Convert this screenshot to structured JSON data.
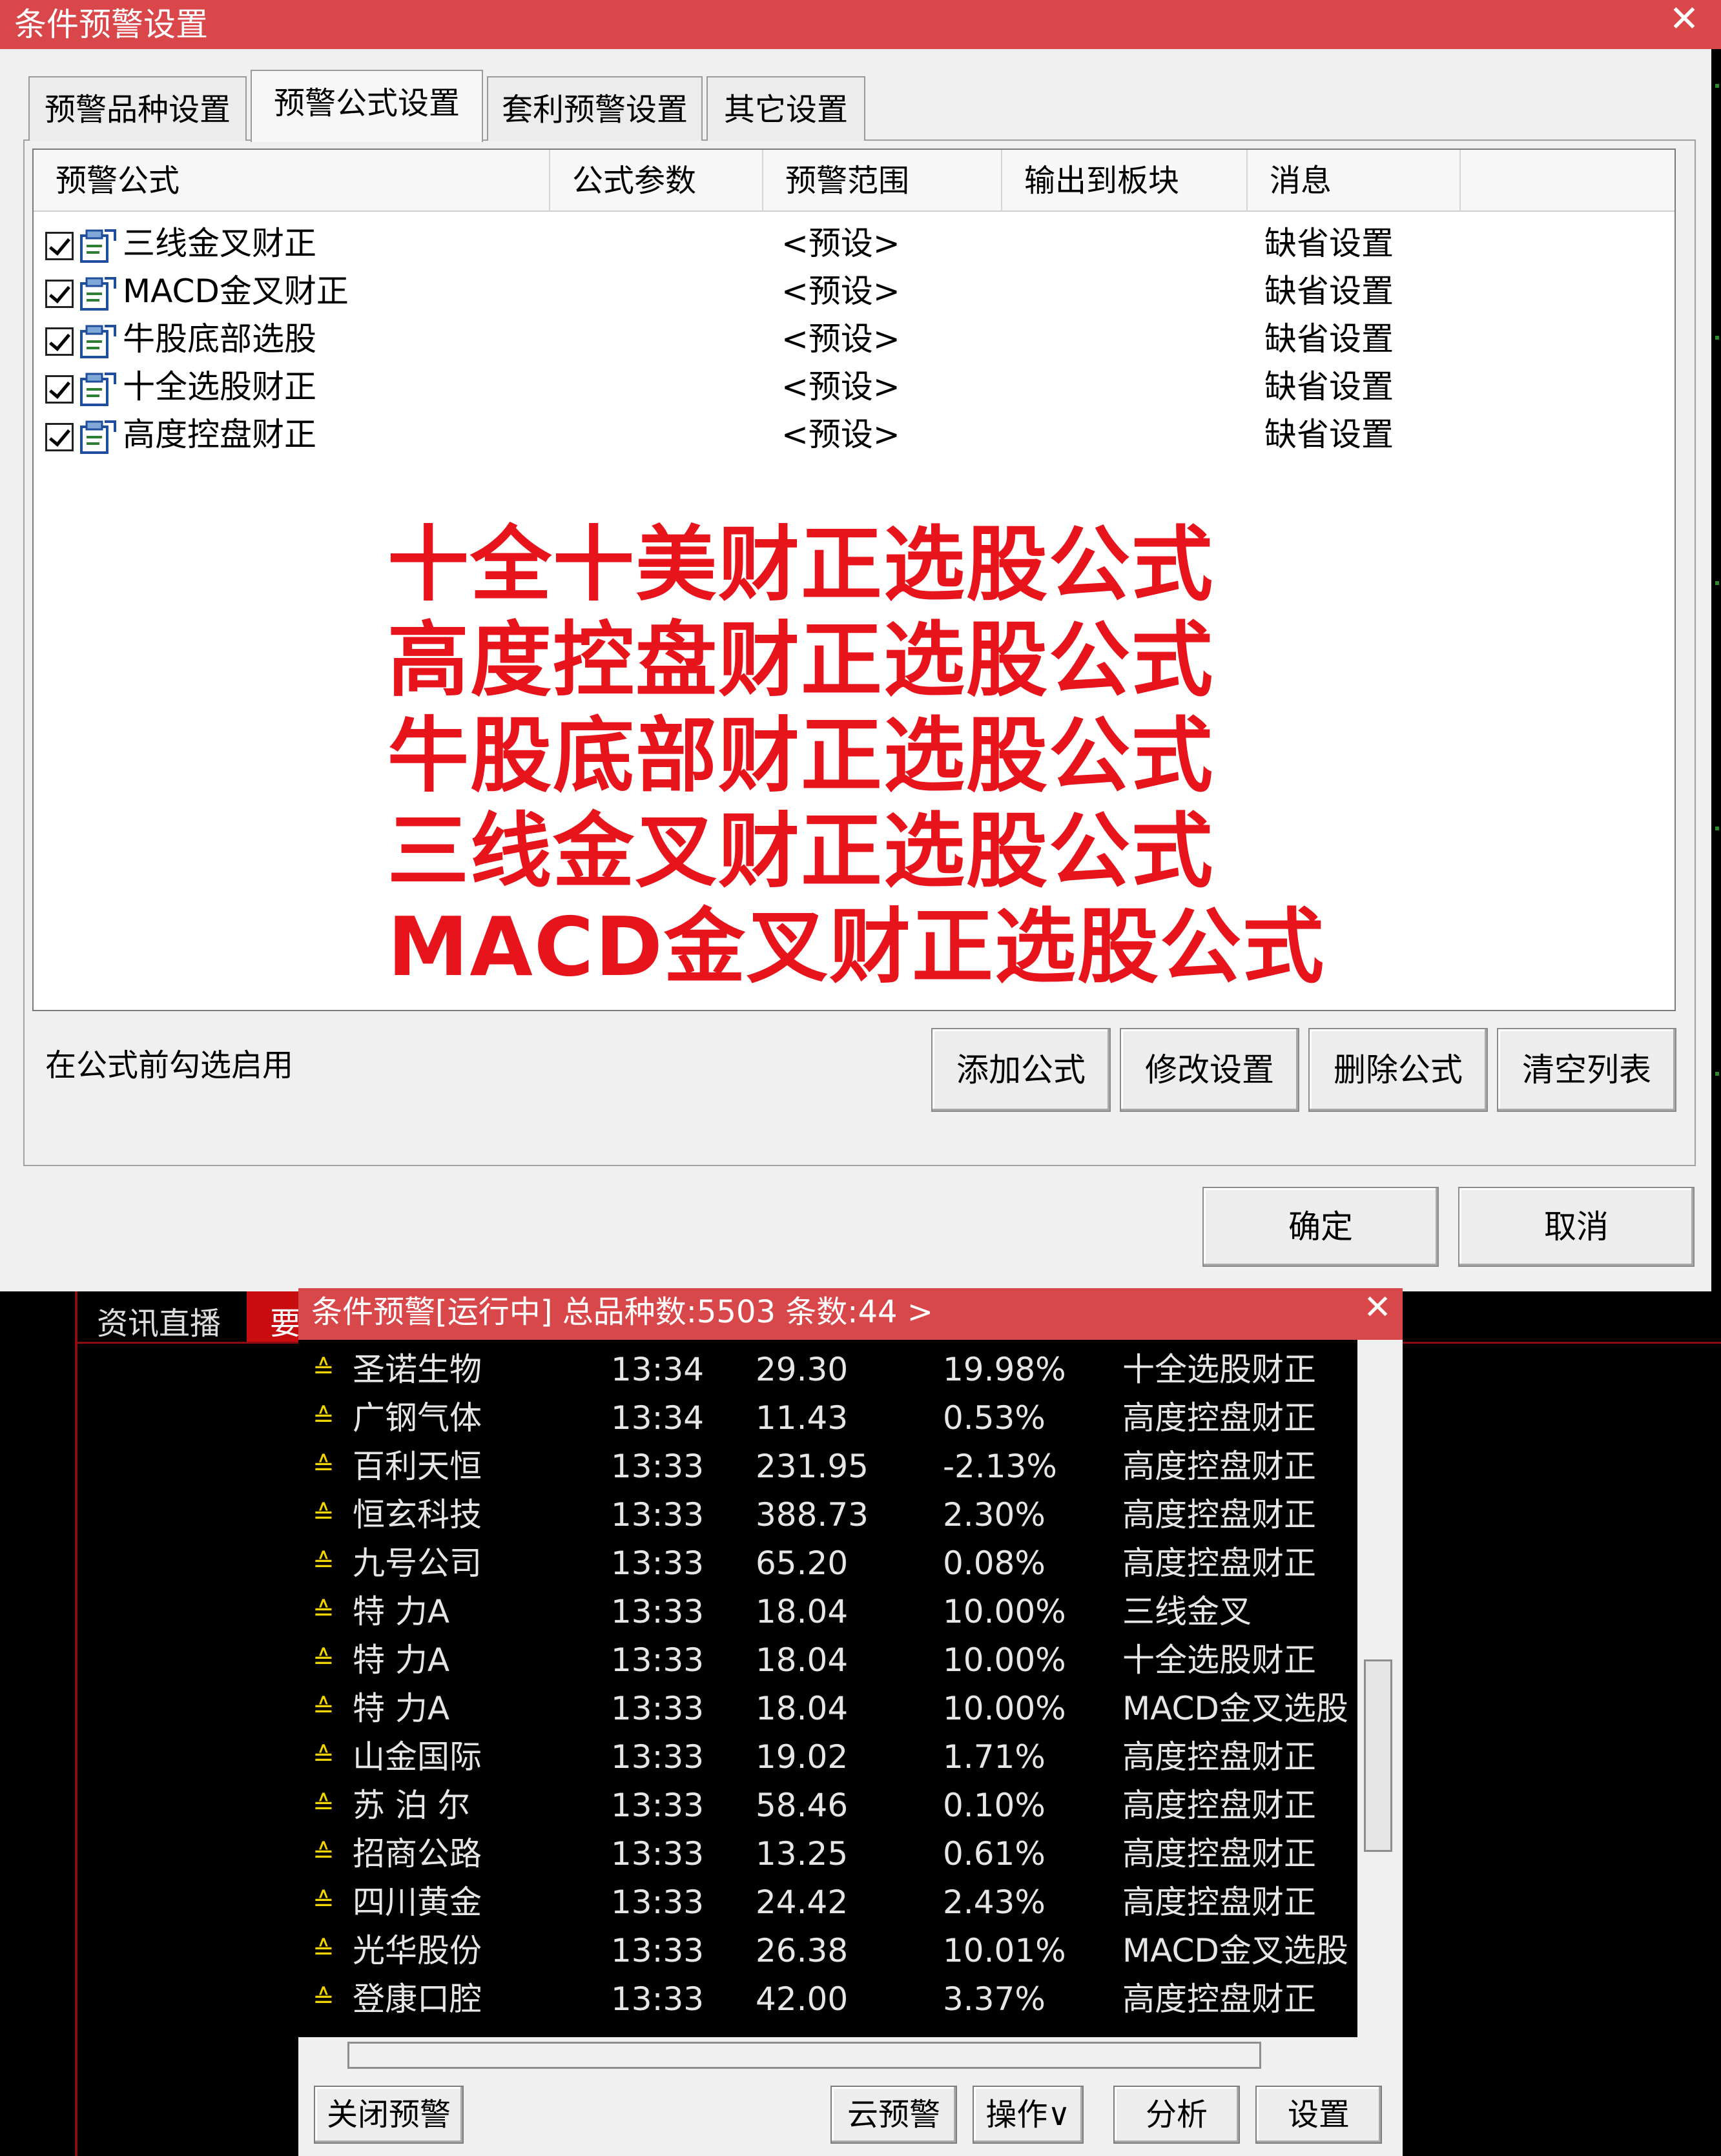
{
  "dialog": {
    "title": "条件预警设置",
    "close_glyph": "✕",
    "tabs": [
      "预警品种设置",
      "预警公式设置",
      "套利预警设置",
      "其它设置"
    ],
    "active_tab": "预警公式设置",
    "columns": [
      "预警公式",
      "公式参数",
      "预警范围",
      "输出到板块",
      "消息"
    ],
    "rows": [
      {
        "name": "三线金叉财正",
        "range": "<预设>",
        "msg": "缺省设置",
        "checked": true
      },
      {
        "name": "MACD金叉财正",
        "range": "<预设>",
        "msg": "缺省设置",
        "checked": true
      },
      {
        "name": "牛股底部选股",
        "range": "<预设>",
        "msg": "缺省设置",
        "checked": true
      },
      {
        "name": "十全选股财正",
        "range": "<预设>",
        "msg": "缺省设置",
        "checked": true
      },
      {
        "name": "高度控盘财正",
        "range": "<预设>",
        "msg": "缺省设置",
        "checked": true
      }
    ],
    "overlay_lines": [
      "十全十美财正选股公式",
      "高度控盘财正选股公式",
      "牛股底部财正选股公式",
      "三线金叉财正选股公式",
      "MACD金叉财正选股公式"
    ],
    "hint": "在公式前勾选启用",
    "buttons": {
      "add": "添加公式",
      "modify": "修改设置",
      "delete": "删除公式",
      "clear": "清空列表"
    },
    "ok": "确定",
    "cancel": "取消"
  },
  "background": {
    "news_tab": "资讯直播",
    "news_tab_cut": "要"
  },
  "alert_window": {
    "title": "条件预警[运行中] 总品种数:5503 条数:44  >",
    "close_glyph": "✕",
    "rows": [
      {
        "name": "圣诺生物",
        "time": "13:34",
        "price": "29.30",
        "pct": "19.98%",
        "formula": "十全选股财正"
      },
      {
        "name": "广钢气体",
        "time": "13:34",
        "price": "11.43",
        "pct": "0.53%",
        "formula": "高度控盘财正"
      },
      {
        "name": "百利天恒",
        "time": "13:33",
        "price": "231.95",
        "pct": "-2.13%",
        "formula": "高度控盘财正"
      },
      {
        "name": "恒玄科技",
        "time": "13:33",
        "price": "388.73",
        "pct": "2.30%",
        "formula": "高度控盘财正"
      },
      {
        "name": "九号公司",
        "time": "13:33",
        "price": "65.20",
        "pct": "0.08%",
        "formula": "高度控盘财正"
      },
      {
        "name": "特 力A",
        "time": "13:33",
        "price": "18.04",
        "pct": "10.00%",
        "formula": "三线金叉"
      },
      {
        "name": "特 力A",
        "time": "13:33",
        "price": "18.04",
        "pct": "10.00%",
        "formula": "十全选股财正"
      },
      {
        "name": "特 力A",
        "time": "13:33",
        "price": "18.04",
        "pct": "10.00%",
        "formula": "MACD金叉选股"
      },
      {
        "name": "山金国际",
        "time": "13:33",
        "price": "19.02",
        "pct": "1.71%",
        "formula": "高度控盘财正"
      },
      {
        "name": "苏 泊 尔",
        "time": "13:33",
        "price": "58.46",
        "pct": "0.10%",
        "formula": "高度控盘财正"
      },
      {
        "name": "招商公路",
        "time": "13:33",
        "price": "13.25",
        "pct": "0.61%",
        "formula": "高度控盘财正"
      },
      {
        "name": "四川黄金",
        "time": "13:33",
        "price": "24.42",
        "pct": "2.43%",
        "formula": "高度控盘财正"
      },
      {
        "name": "光华股份",
        "time": "13:33",
        "price": "26.38",
        "pct": "10.01%",
        "formula": "MACD金叉选股"
      },
      {
        "name": "登康口腔",
        "time": "13:33",
        "price": "42.00",
        "pct": "3.37%",
        "formula": "高度控盘财正"
      }
    ],
    "row_icon": "up-arrow-icon",
    "buttons": {
      "close": "关闭预警",
      "cloud": "云预警",
      "op": "操作∨",
      "analyze": "分析",
      "settings": "设置"
    }
  },
  "colors": {
    "title_bar": "#d9474a",
    "overlay_text": "#e8141c",
    "arrow": "#f2d500"
  }
}
